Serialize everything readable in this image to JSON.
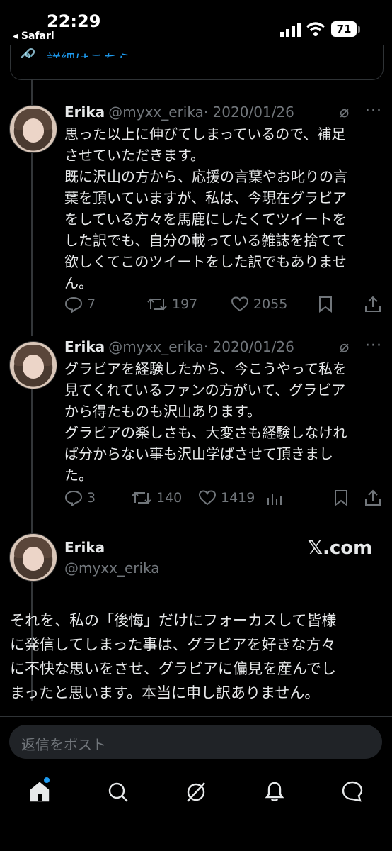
{
  "status_bar": {
    "time": "22:29",
    "back_app": "◂ Safari",
    "battery": "71"
  },
  "prior_card": {
    "link_partial": "詳細はこちら"
  },
  "tweets": [
    {
      "name": "Erika",
      "handle": "@myxx_erika",
      "date": "· 2020/01/26",
      "lines": [
        "思った以上に伸びてしまっているので、補足",
        "させていただきます。",
        "既に沢山の方から、応援の言葉やお叱りの言",
        "葉を頂いていますが、私は、今現在グラビア",
        "をしている方々を馬鹿にしたくてツイートを",
        "した訳でも、自分の載っている雑誌を捨てて",
        "欲しくてこのツイートをした訳でもありませ",
        "ん。"
      ],
      "replies": "7",
      "reposts": "197",
      "likes": "2055"
    },
    {
      "name": "Erika",
      "handle": "@myxx_erika",
      "date": "· 2020/01/26",
      "lines": [
        "グラビアを経験したから、今こうやって私を",
        "見てくれているファンの方がいて、グラビア",
        "から得たものも沢山あります。",
        "グラビアの楽しさも、大変さも経験しなけれ",
        "ば分からない事も沢山学ばさせて頂きまし",
        "た。"
      ],
      "replies": "3",
      "reposts": "140",
      "likes": "1419"
    }
  ],
  "embed": {
    "name": "Erika",
    "handle": "@myxx_erika",
    "source": "𝕏.com",
    "lines": [
      "それを、私の「後悔」だけにフォーカスして皆様",
      "に発信してしまった事は、グラビアを好きな方々",
      "に不快な思いをさせ、グラビアに偏見を産んでし",
      "まったと思います。本当に申し訳ありません。"
    ]
  },
  "compose": {
    "placeholder": "返信をポスト"
  },
  "colors": {
    "accent": "#1d9bf0",
    "muted": "#71767b",
    "background": "#000000"
  }
}
